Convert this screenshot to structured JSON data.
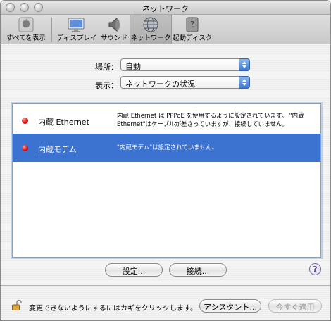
{
  "window": {
    "title": "ネットワーク"
  },
  "toolbar": {
    "items": [
      {
        "label": "すべてを表示",
        "icon": "show-all-icon"
      },
      {
        "label": "ディスプレイ",
        "icon": "display-icon"
      },
      {
        "label": "サウンド",
        "icon": "speaker-icon"
      },
      {
        "label": "ネットワーク",
        "icon": "network-globe-icon"
      },
      {
        "label": "起動ディスク",
        "icon": "startup-disk-icon"
      }
    ]
  },
  "location": {
    "label": "場所：",
    "value": "自動"
  },
  "show": {
    "label": "表示：",
    "value": "ネットワークの状況"
  },
  "interfaces": [
    {
      "name": "内蔵 Ethernet",
      "status_color": "#d11111",
      "description": "内蔵 Ethernet は PPPoE を使用するように設定されています。 \"内蔵 Ethernet\"はケーブルが差さっていますが、接続していません。"
    },
    {
      "name": "内蔵モデム",
      "status_color": "#d11111",
      "description": "\"内蔵モデム\"は設定されていません。"
    }
  ],
  "buttons": {
    "configure": "設定...",
    "connect": "接続...",
    "help": "?",
    "assistant": "アシスタント...",
    "apply_now": "今すぐ適用"
  },
  "lock": {
    "text": "変更できないようにするにはカギをクリックします。"
  },
  "colors": {
    "selection": "#3d73d0",
    "status_dot": "#d11111",
    "accent": "#3b79d4"
  }
}
